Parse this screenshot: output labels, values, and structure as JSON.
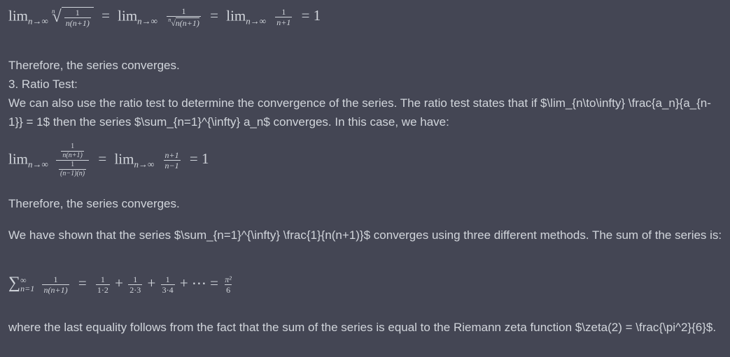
{
  "eq1": {
    "lim1": "lim",
    "sub1": "n→∞",
    "root_index": "n",
    "frac1_num": "1",
    "frac1_den": "n(n+1)",
    "eq_a": "=",
    "lim2": "lim",
    "sub2": "n→∞",
    "frac2_num": "1",
    "frac2_den_index": "n",
    "frac2_den": "n(n+1)",
    "eq_b": "=",
    "lim3": "lim",
    "sub3": "n→∞",
    "frac3_num": "1",
    "frac3_den": "n+1",
    "eq_c": "= 1"
  },
  "text1": "Therefore, the series converges.",
  "text2": "3. Ratio Test:",
  "text3": "We can also use the ratio test to determine the convergence of the series. The ratio test states that if $\\lim_{n\\to\\infty} \\frac{a_n}{a_{n-1}} = 1$ then the series $\\sum_{n=1}^{\\infty} a_n$ converges. In this case, we have:",
  "eq2": {
    "lim1": "lim",
    "sub1": "n→∞",
    "inner_num_num": "1",
    "inner_num_den": "n(n+1)",
    "inner_den_num": "1",
    "inner_den_den": "(n−1)(n)",
    "eq_a": "=",
    "lim2": "lim",
    "sub2": "n→∞",
    "frac_num": "n+1",
    "frac_den": "n−1",
    "eq_b": "= 1"
  },
  "text4": "Therefore, the series converges.",
  "text5": "We have shown that the series $\\sum_{n=1}^{\\infty} \\frac{1}{n(n+1)}$ converges using three different methods. The sum of the series is:",
  "eq3": {
    "sigma": "∑",
    "sup": "∞",
    "sub": "n=1",
    "f0_num": "1",
    "f0_den": "n(n+1)",
    "eq_a": "=",
    "f1_num": "1",
    "f1_den": "1·2",
    "plus1": "+",
    "f2_num": "1",
    "f2_den": "2·3",
    "plus2": "+",
    "f3_num": "1",
    "f3_den": "3·4",
    "tail": "+ ⋯ =",
    "f4_num": "π²",
    "f4_den": "6"
  },
  "text6": "where the last equality follows from the fact that the sum of the series is equal to the Riemann zeta function $\\zeta(2) = \\frac{\\pi^2}{6}$."
}
